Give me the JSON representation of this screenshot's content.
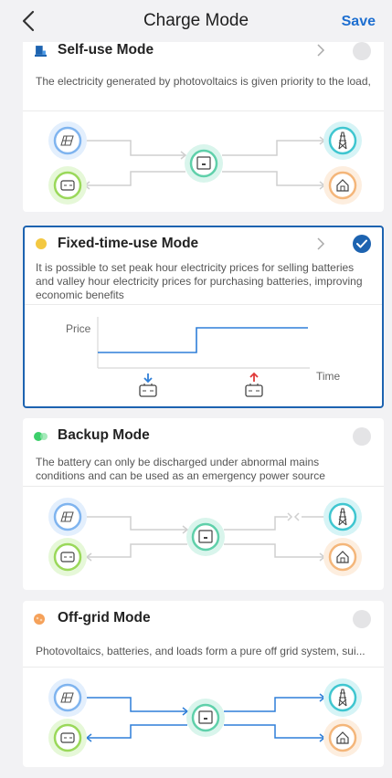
{
  "header": {
    "title": "Charge Mode",
    "save_label": "Save"
  },
  "modes": [
    {
      "name": "Self-use Mode",
      "description": "The electricity generated by photovoltaics is given priority to the load, the excess electricity is used to charge the battery, and the r...",
      "selected": false,
      "icon": "house-battery-icon"
    },
    {
      "name": "Fixed-time-use Mode",
      "description": "It is possible to set peak hour electricity prices for selling batteries and valley hour electricity prices for purchasing batteries, improving economic benefits",
      "selected": true,
      "icon": "sun-dot-icon",
      "chart": {
        "price_label": "Price",
        "time_label": "Time"
      }
    },
    {
      "name": "Backup Mode",
      "description": "The battery can only be discharged under abnormal mains conditions and can be used as an emergency power source",
      "selected": false,
      "icon": "green-dots-icon"
    },
    {
      "name": "Off-grid  Mode",
      "description": "Photovoltaics, batteries, and loads form a pure off grid system, sui...",
      "selected": false,
      "icon": "orange-dot-icon"
    }
  ],
  "colors": {
    "accent": "#1d63b0",
    "save": "#1e6fd0",
    "flow_blue": "#2f7fd8",
    "up_arrow": "#e03a3a"
  }
}
